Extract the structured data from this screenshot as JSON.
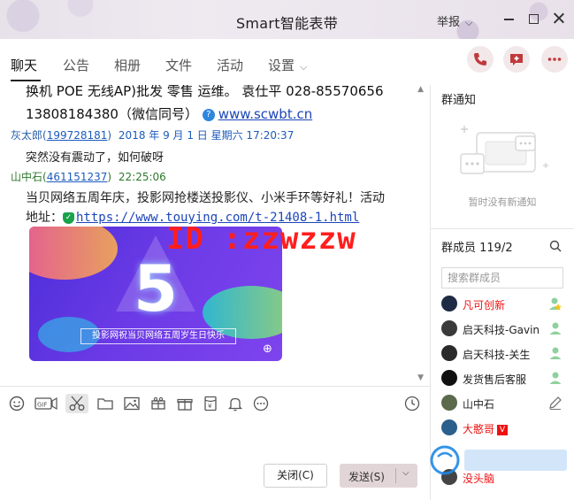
{
  "window": {
    "title": "Smart智能表带",
    "report_label": "举报"
  },
  "tabs": [
    {
      "label": "聊天"
    },
    {
      "label": "公告"
    },
    {
      "label": "相册"
    },
    {
      "label": "文件"
    },
    {
      "label": "活动"
    },
    {
      "label": "设置"
    }
  ],
  "chat": {
    "line1": "换机 POE 无线AP)批发 零售 运维。 袁仕平 028-85570656",
    "line2_phone": "13808184380（微信同号）",
    "line2_link": "www.scwbt.cn",
    "msg1": {
      "sender": "灰太郎(",
      "uid": "199728181",
      "close": ")",
      "time": "2018 年 9 月 1 日 星期六 17:20:37",
      "text": "突然没有震动了，如何破呀"
    },
    "msg2": {
      "sender": "山中石(",
      "uid": "461151237",
      "close": ")",
      "time": "22:25:06",
      "text1": "当贝网络五周年庆，投影网抢楼送投影仪、小米手环等好礼！活动",
      "text2_prefix": "地址：",
      "link": "https://www.touying.com/t-21408-1.html",
      "banner_caption": "投影网祝当贝网络五周岁生日快乐",
      "banner_number": "5"
    },
    "overlay_id": "ID :zzwzzw"
  },
  "buttons": {
    "close": "关闭(C)",
    "send": "发送(S)"
  },
  "right": {
    "notice_title": "群通知",
    "notice_empty": "暂时没有新通知",
    "members_title": "群成员 119/2",
    "search_placeholder": "搜索群成员",
    "members": [
      {
        "name": "凡可创新",
        "highlight": true
      },
      {
        "name": "启天科技-Gavin",
        "highlight": false
      },
      {
        "name": "启天科技-关生",
        "highlight": false
      },
      {
        "name": "发货售后客服",
        "highlight": false
      },
      {
        "name": "山中石",
        "highlight": false
      },
      {
        "name": "大憨哥",
        "highlight": true
      },
      {
        "name": "没头脑",
        "highlight": true
      }
    ],
    "vip_badge": "V"
  },
  "colors": {
    "accent": "#c0393b",
    "link": "#1c46b8",
    "highlight_name": "#e11111"
  }
}
